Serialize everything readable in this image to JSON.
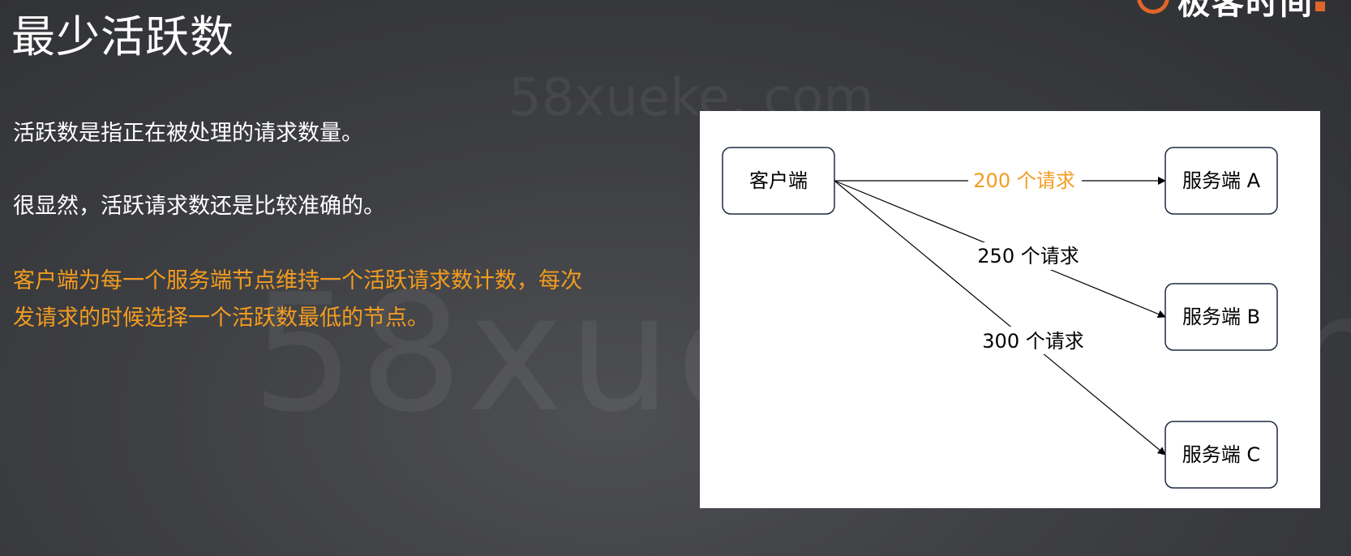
{
  "slide": {
    "title": "最少活跃数",
    "paragraphs": {
      "p1": "活跃数是指正在被处理的请求数量。",
      "p2": "很显然，活跃请求数还是比较准确的。",
      "p3": "客户端为每一个服务端节点维持一个活跃请求数计数，每次发请求的时候选择一个活跃数最低的节点。"
    },
    "highlight_color": "#f39c1f",
    "watermark": "58xueke. com"
  },
  "diagram": {
    "nodes": {
      "client": "客户端",
      "server_a": "服务端 A",
      "server_b": "服务端 B",
      "server_c": "服务端 C"
    },
    "edges": {
      "to_a": "200 个请求",
      "to_b": "250 个请求",
      "to_c": "300 个请求"
    },
    "highlight_edge": "to_a",
    "highlight_color": "#f39c1f"
  }
}
